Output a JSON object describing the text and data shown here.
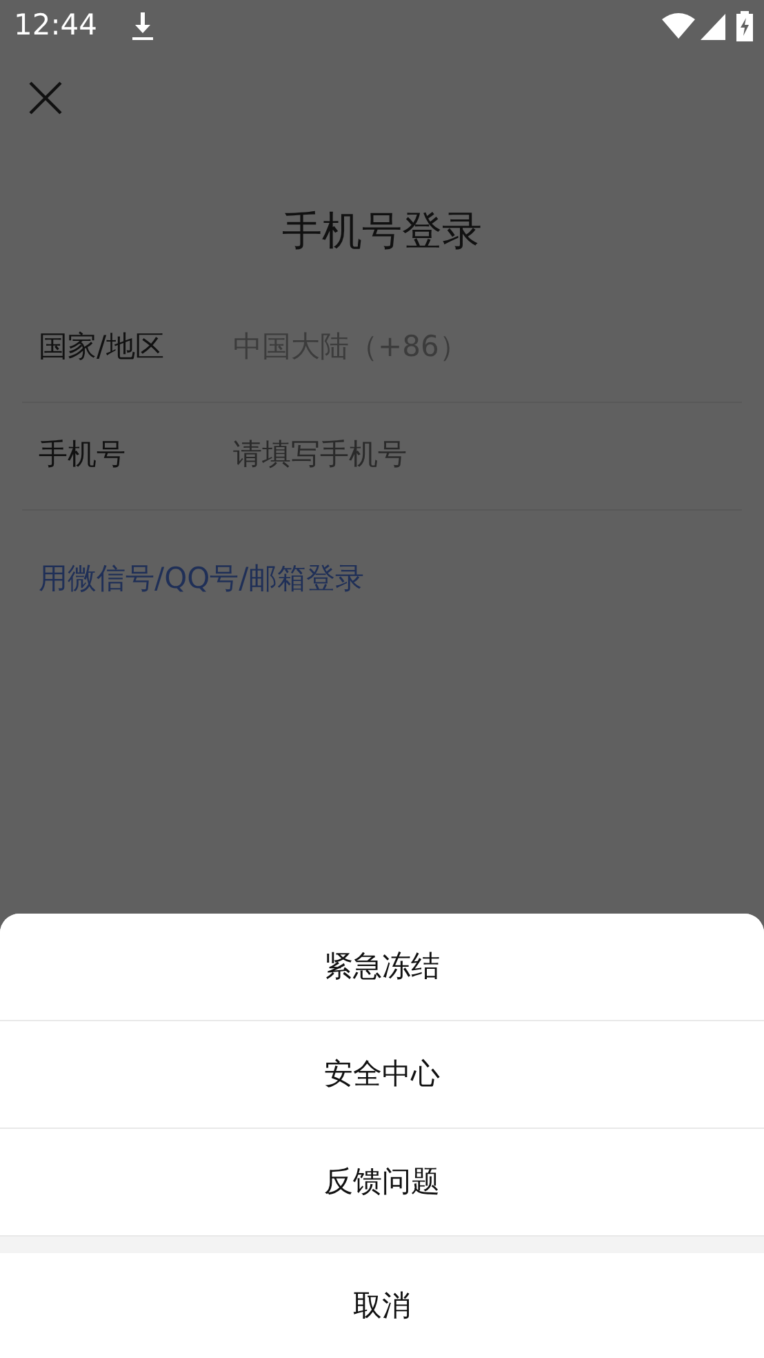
{
  "status_bar": {
    "time": "12:44"
  },
  "title": "手机号登录",
  "form": [
    {
      "label": "国家/地区",
      "value": "中国大陆（+86）"
    },
    {
      "label": "手机号",
      "placeholder": "请填写手机号"
    }
  ],
  "alt_login_link": "用微信号/QQ号/邮箱登录",
  "action_sheet": {
    "items": [
      "紧急冻结",
      "安全中心",
      "反馈问题"
    ],
    "cancel": "取消"
  }
}
